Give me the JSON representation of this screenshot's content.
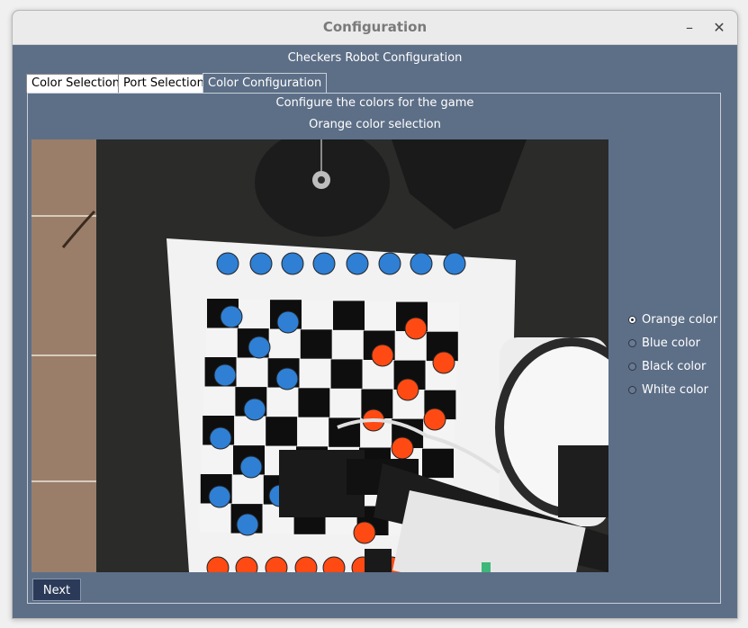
{
  "window": {
    "title": "Configuration",
    "minimize_glyph": "–",
    "close_glyph": "✕"
  },
  "header": {
    "title": "Checkers Robot Configuration"
  },
  "tabs": [
    {
      "label": "Color Selection",
      "active": false
    },
    {
      "label": "Port Selection",
      "active": false
    },
    {
      "label": "Color Configuration",
      "active": true
    }
  ],
  "panel": {
    "instruction": "Configure the colors for the game",
    "subtitle": "Orange color selection"
  },
  "camera": {
    "description_icon": "camera-feed",
    "colors": {
      "blue_piece": "#2f7fd4",
      "orange_piece": "#ff4a14",
      "board_white": "#f4f4f4",
      "board_black": "#0e0e0e",
      "table": "#2d2d2c"
    }
  },
  "color_options": [
    {
      "label": "Orange color",
      "checked": true
    },
    {
      "label": "Blue color",
      "checked": false
    },
    {
      "label": "Black color",
      "checked": false
    },
    {
      "label": "White color",
      "checked": false
    }
  ],
  "actions": {
    "next_label": "Next"
  },
  "theme": {
    "window_bg": "#5d6f87",
    "button_bg": "#2b3a58"
  }
}
